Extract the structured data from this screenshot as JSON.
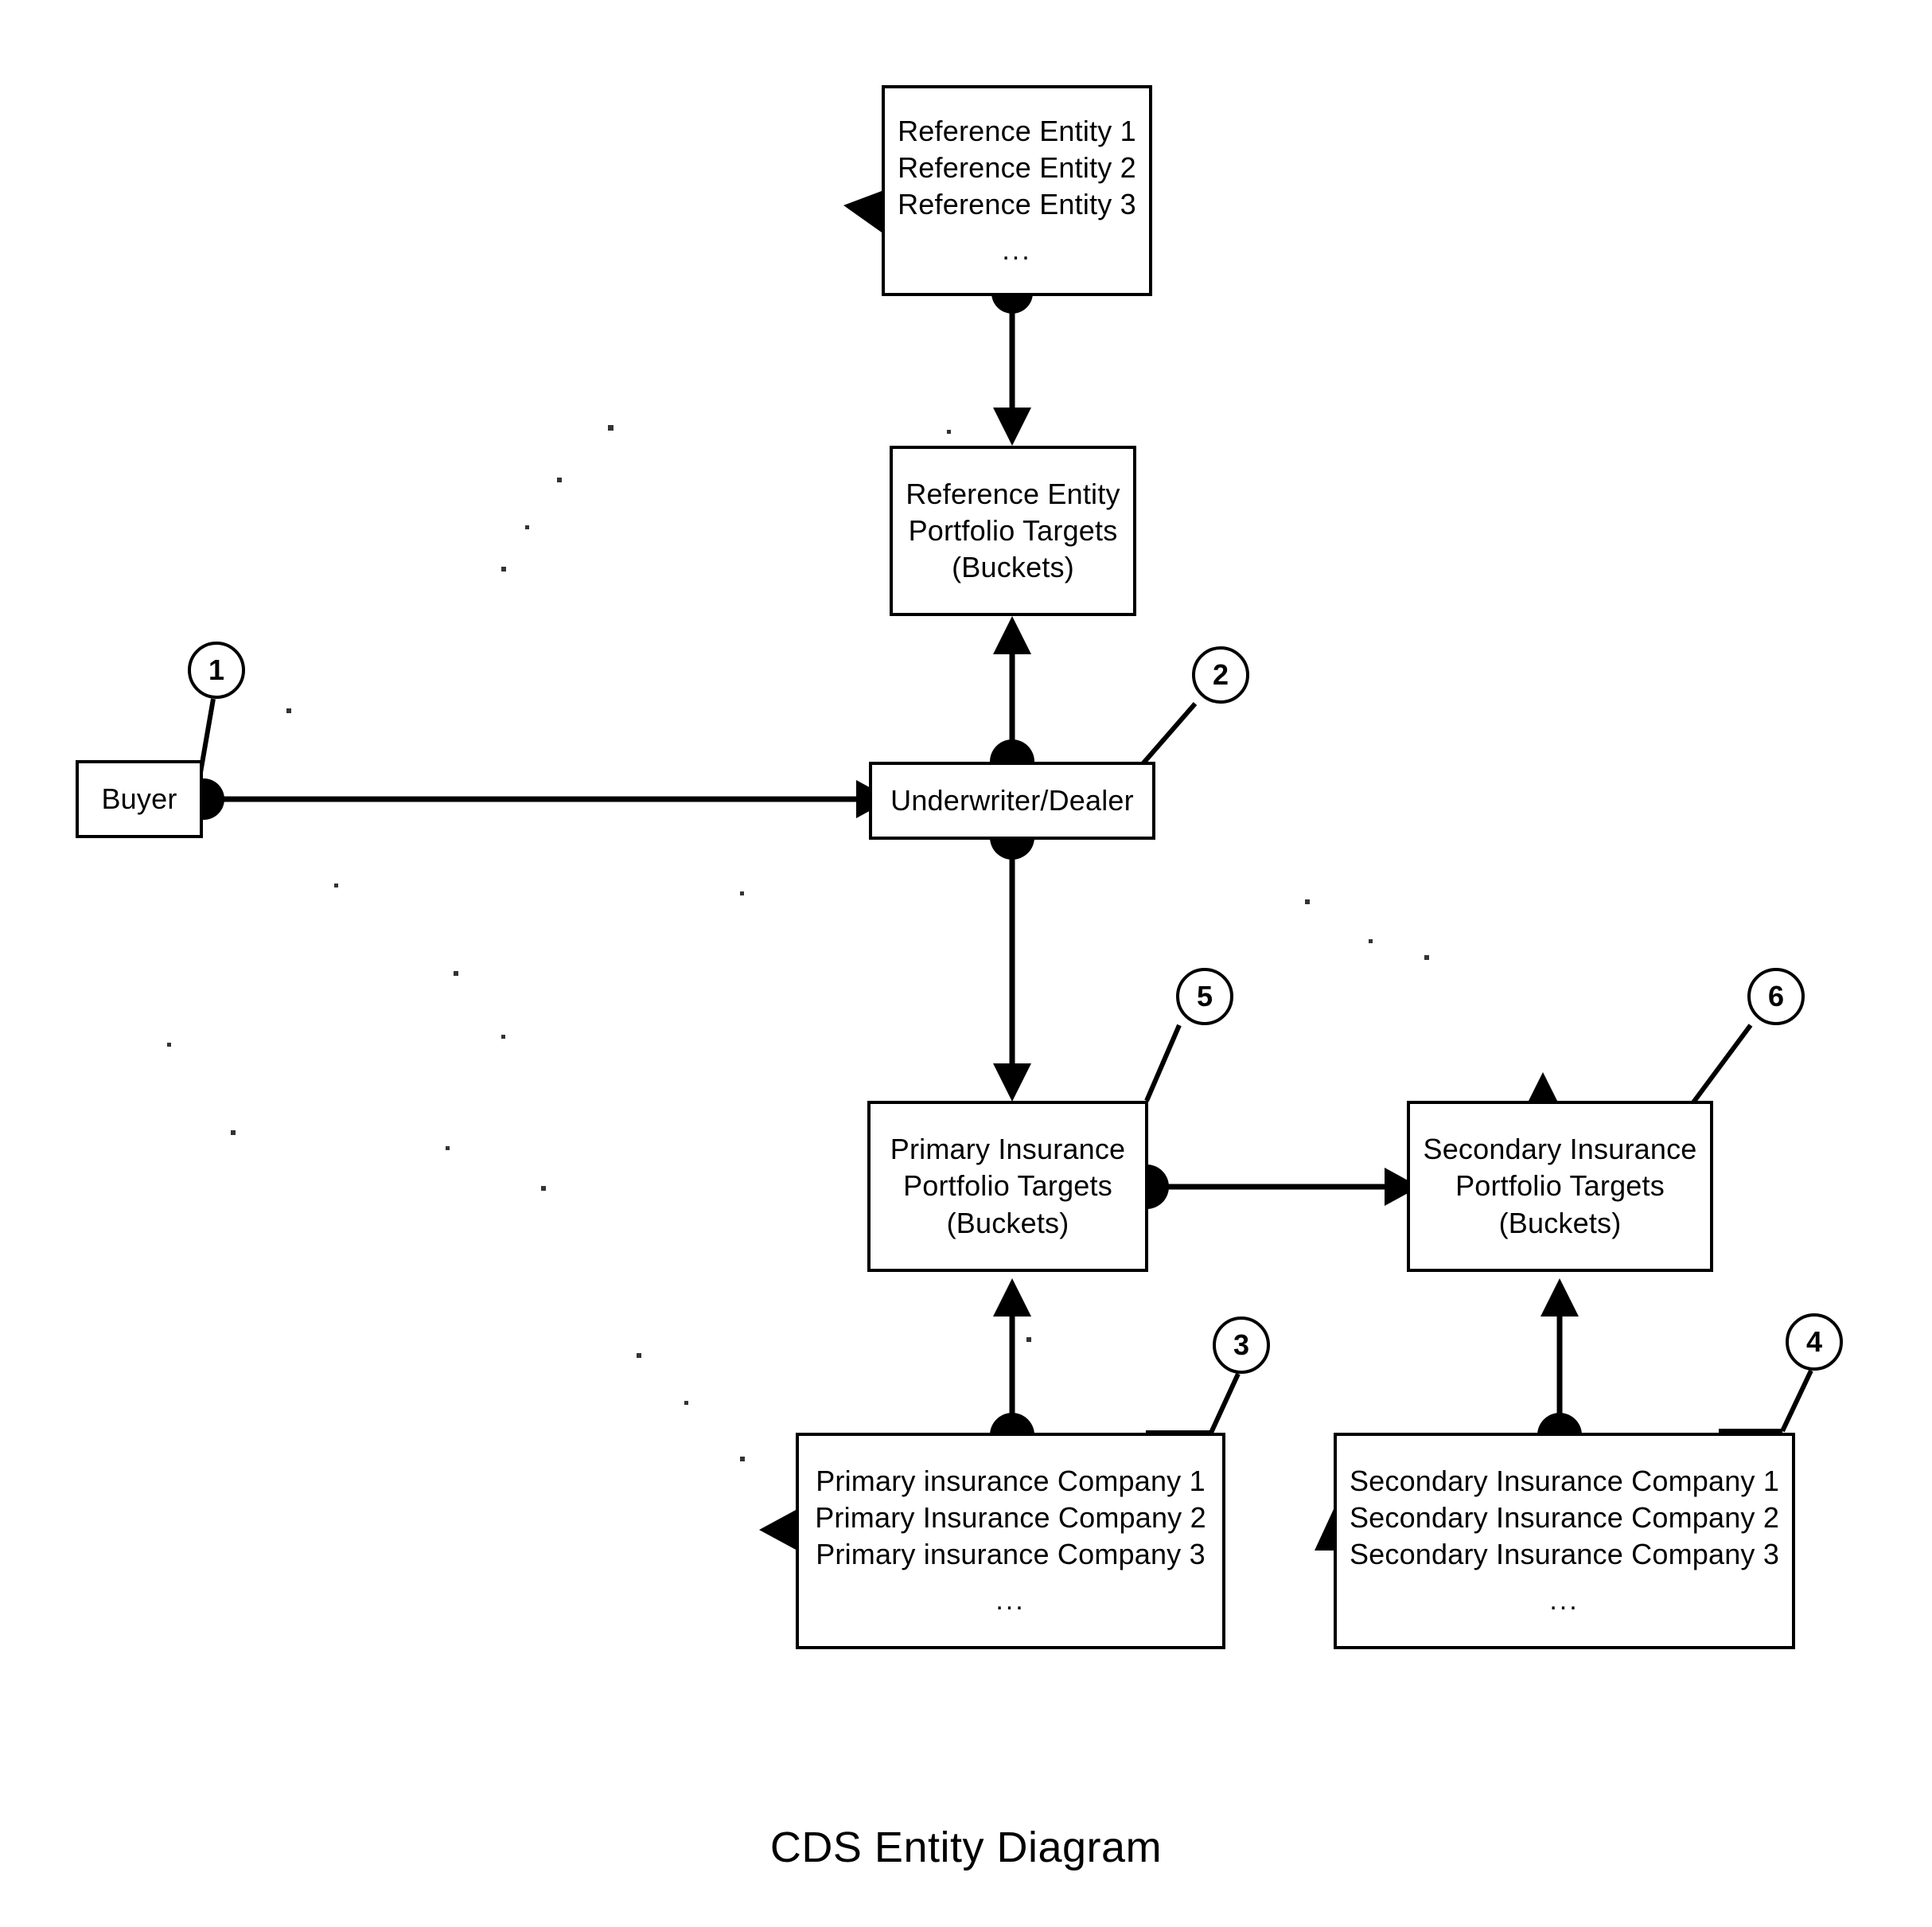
{
  "diagram": {
    "caption": "CDS Entity Diagram",
    "colors": {
      "stroke": "#000000",
      "fill": "#ffffff",
      "text": "#000000"
    },
    "nodes": {
      "reference_entities": {
        "name": "Reference Entities",
        "lines": [
          "Reference Entity 1",
          "Reference Entity 2",
          "Reference Entity 3"
        ],
        "ellipsis": "..."
      },
      "reference_entity_targets": {
        "name": "Reference Entity Portfolio Targets",
        "lines": [
          "Reference Entity",
          "Portfolio Targets",
          "(Buckets)"
        ]
      },
      "buyer": {
        "name": "Buyer",
        "lines": [
          "Buyer"
        ]
      },
      "underwriter": {
        "name": "Underwriter/Dealer",
        "lines": [
          "Underwriter/Dealer"
        ]
      },
      "primary_targets": {
        "name": "Primary Insurance Portfolio Targets",
        "lines": [
          "Primary Insurance",
          "Portfolio Targets",
          "(Buckets)"
        ]
      },
      "secondary_targets": {
        "name": "Secondary Insurance Portfolio Targets",
        "lines": [
          "Secondary Insurance",
          "Portfolio Targets",
          "(Buckets)"
        ]
      },
      "primary_companies": {
        "name": "Primary Insurance Companies",
        "lines": [
          "Primary insurance Company 1",
          "Primary Insurance Company 2",
          "Primary insurance Company 3"
        ],
        "ellipsis": "..."
      },
      "secondary_companies": {
        "name": "Secondary Insurance Companies",
        "lines": [
          "Secondary Insurance Company 1",
          "Secondary Insurance Company 2",
          "Secondary Insurance Company 3"
        ],
        "ellipsis": "..."
      }
    },
    "callouts": [
      {
        "id": "callout-1",
        "label": "1",
        "target": "buyer"
      },
      {
        "id": "callout-2",
        "label": "2",
        "target": "underwriter"
      },
      {
        "id": "callout-3",
        "label": "3",
        "target": "primary_companies"
      },
      {
        "id": "callout-4",
        "label": "4",
        "target": "secondary_companies"
      },
      {
        "id": "callout-5",
        "label": "5",
        "target": "primary_targets"
      },
      {
        "id": "callout-6",
        "label": "6",
        "target": "secondary_targets"
      }
    ],
    "connections": [
      {
        "id": "conn-ref-to-ref-targets",
        "from": "reference_entities",
        "to": "reference_entity_targets",
        "style": "dot-to-arrow-down"
      },
      {
        "id": "conn-underwriter-to-ref-targets",
        "from": "underwriter",
        "to": "reference_entity_targets",
        "style": "dot-to-arrow-up"
      },
      {
        "id": "conn-buyer-to-underwriter",
        "from": "buyer",
        "to": "underwriter",
        "style": "dot-to-arrow-right"
      },
      {
        "id": "conn-underwriter-to-primary-targets",
        "from": "underwriter",
        "to": "primary_targets",
        "style": "dot-to-arrow-down"
      },
      {
        "id": "conn-primary-companies-to-primary-targets",
        "from": "primary_companies",
        "to": "primary_targets",
        "style": "dot-to-arrow-up"
      },
      {
        "id": "conn-primary-targets-to-secondary-targets",
        "from": "primary_targets",
        "to": "secondary_targets",
        "style": "dot-to-arrow-right"
      },
      {
        "id": "conn-secondary-companies-to-secondary-targets",
        "from": "secondary_companies",
        "to": "secondary_targets",
        "style": "dot-to-arrow-up"
      }
    ],
    "edge_markers": [
      {
        "id": "marker-reference-entities-left",
        "shape": "arrowhead-left"
      },
      {
        "id": "marker-secondary-targets-top",
        "shape": "arrowhead-up"
      },
      {
        "id": "marker-primary-companies-left",
        "shape": "arrowhead-left"
      },
      {
        "id": "marker-secondary-companies-left",
        "shape": "arrowhead-up"
      }
    ]
  }
}
